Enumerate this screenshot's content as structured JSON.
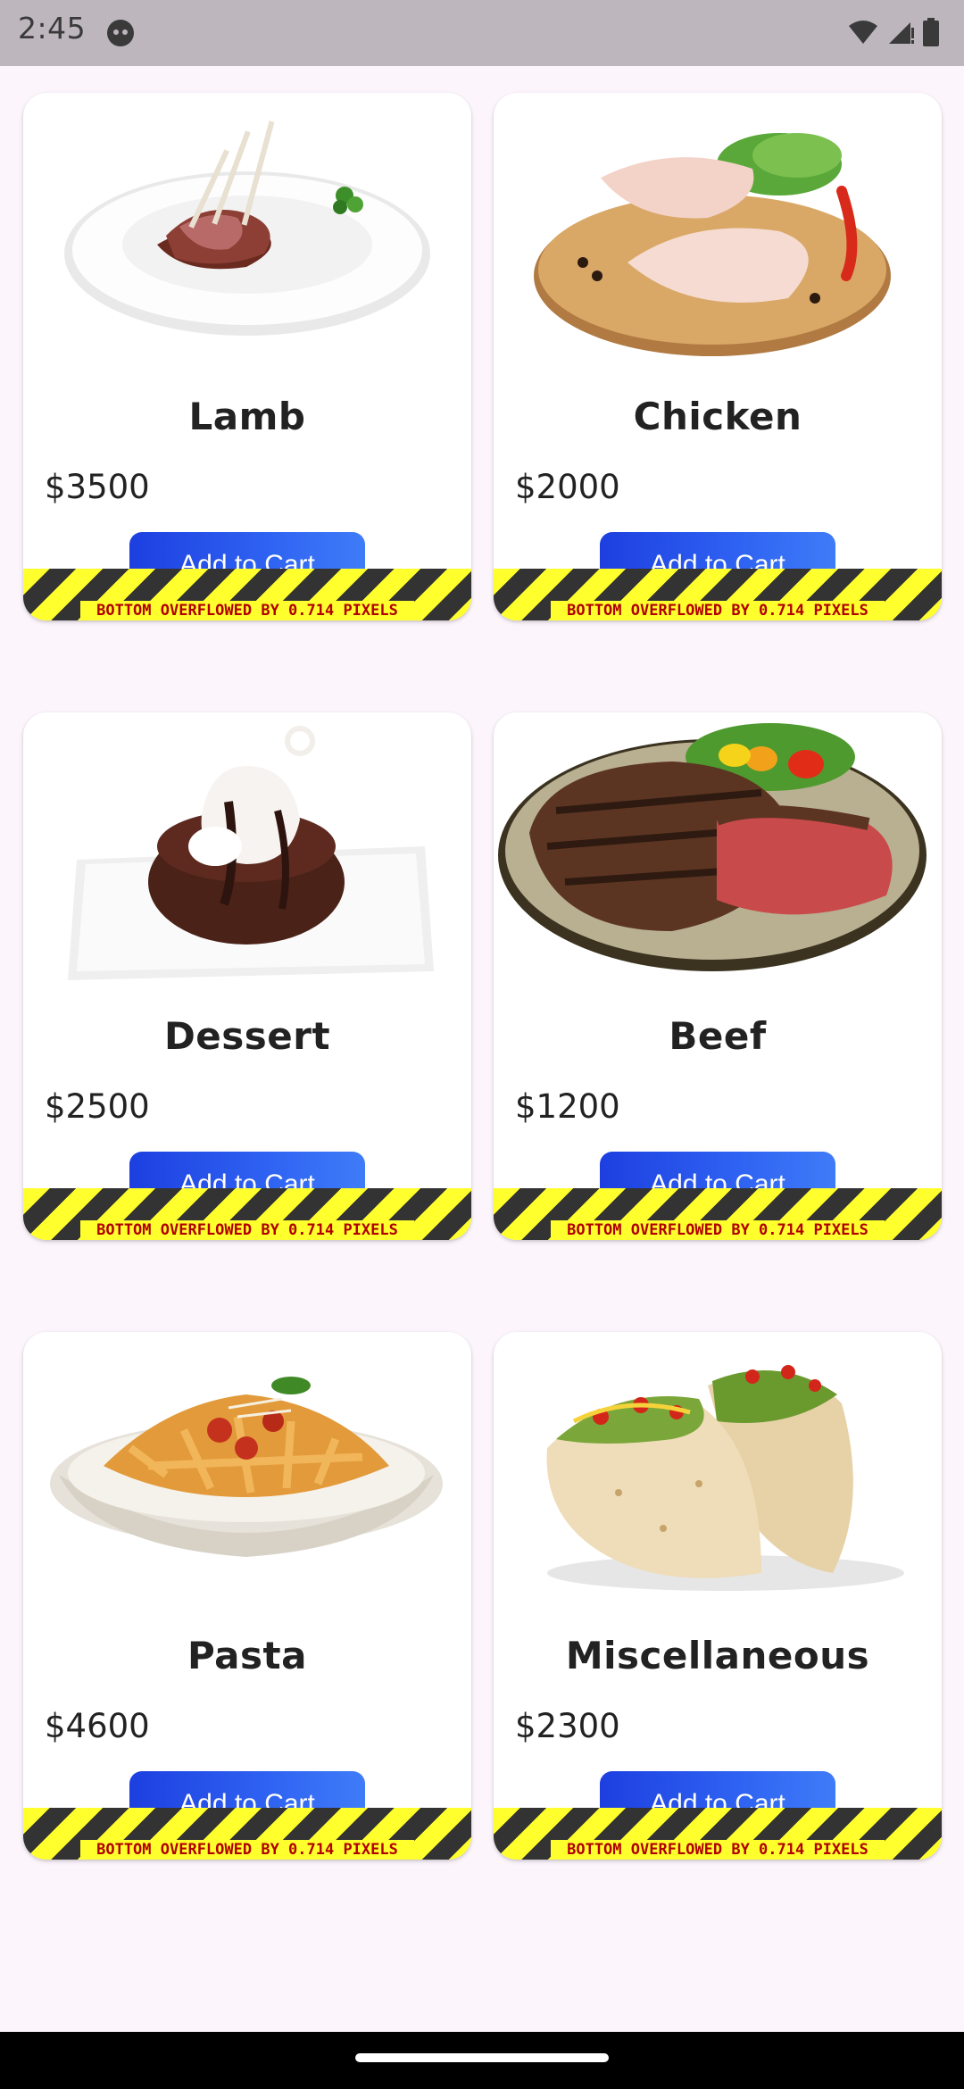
{
  "status_bar": {
    "time": "2:45",
    "icons": [
      "face-icon",
      "wifi-icon",
      "signal-icon",
      "battery-icon"
    ]
  },
  "products": [
    {
      "name": "Lamb",
      "price": "$3500",
      "button": "Add to Cart",
      "overflow_warning": "BOTTOM OVERFLOWED BY 0.714 PIXELS",
      "image": "lamb-rack-plate"
    },
    {
      "name": "Chicken",
      "price": "$2000",
      "button": "Add to Cart",
      "overflow_warning": "BOTTOM OVERFLOWED BY 0.714 PIXELS",
      "image": "raw-chicken-legs"
    },
    {
      "name": "Dessert",
      "price": "$2500",
      "button": "Add to Cart",
      "overflow_warning": "BOTTOM OVERFLOWED BY 0.714 PIXELS",
      "image": "chocolate-lava-cake"
    },
    {
      "name": "Beef",
      "price": "$1200",
      "button": "Add to Cart",
      "overflow_warning": "BOTTOM OVERFLOWED BY 0.714 PIXELS",
      "image": "grilled-steak"
    },
    {
      "name": "Pasta",
      "price": "$4600",
      "button": "Add to Cart",
      "overflow_warning": "BOTTOM OVERFLOWED BY 0.714 PIXELS",
      "image": "penne-bolognese"
    },
    {
      "name": "Miscellaneous",
      "price": "$2300",
      "button": "Add to Cart",
      "overflow_warning": "BOTTOM OVERFLOWED BY 0.714 PIXELS",
      "image": "tacos"
    }
  ],
  "colors": {
    "background": "#fcf5fc",
    "button_start": "#1d3fe0",
    "button_end": "#3f7cf8",
    "warning_yellow": "#ffff2e",
    "warning_dark": "#333333",
    "warning_text": "#b00000"
  }
}
